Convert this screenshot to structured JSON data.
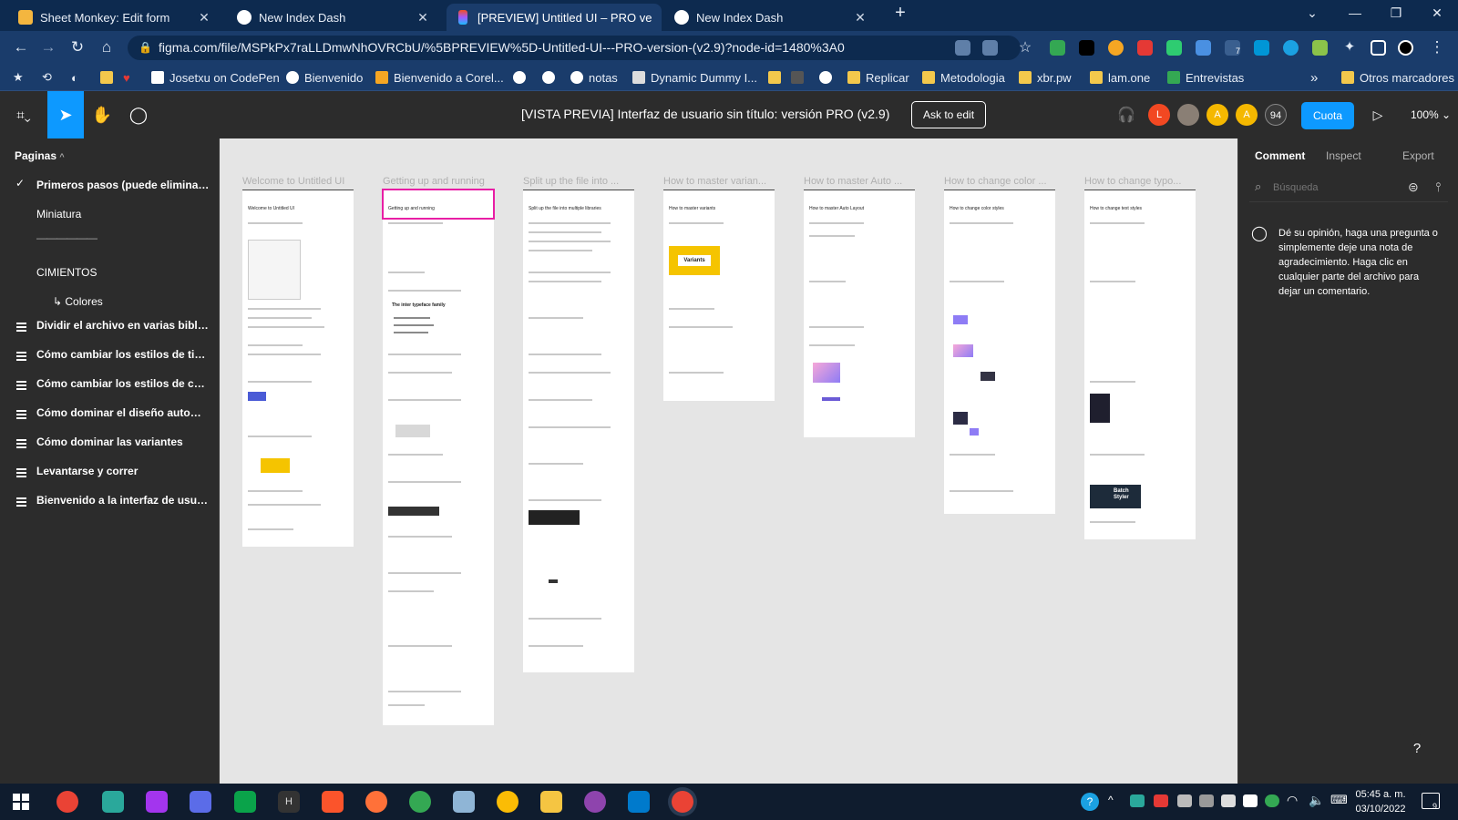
{
  "browser": {
    "tabs": [
      {
        "title": "Sheet Monkey: Edit form",
        "favicon_color": "#f4b63f"
      },
      {
        "title": "New Index Dash",
        "favicon_color": "#ffffff"
      },
      {
        "title": "[PREVIEW] Untitled UI – PRO version",
        "favicon_color": "#f24e1e",
        "active": true
      },
      {
        "title": "New Index Dash",
        "favicon_color": "#ffffff"
      }
    ],
    "url": "figma.com/file/MSPkPx7raLLDmwNhOVRCbU/%5BPREVIEW%5D-Untitled-UI---PRO-version-(v2.9)?node-id=1480%3A0",
    "extension_badge": "7",
    "bookmarks": [
      "Josetxu on CodePen",
      "Bienvenido",
      "Bienvenido a Corel...",
      "notas",
      "Dynamic Dummy I...",
      "Replicar",
      "Metodologia",
      "xbr.pw",
      "lam.one",
      "Entrevistas"
    ],
    "bookmarks_more": "»",
    "other_bookmarks": "Otros marcadores"
  },
  "figma": {
    "file_title": "[VISTA PREVIA] Interfaz de usuario sin título: versión PRO (v2.9)",
    "ask_to_edit": "Ask to edit",
    "avatars": [
      {
        "letter": "L",
        "color": "#f24822"
      },
      {
        "letter": "",
        "color": "#8a7f75"
      },
      {
        "letter": "A",
        "color": "#f5b800"
      },
      {
        "letter": "A",
        "color": "#f5b800"
      }
    ],
    "viewer_count": "94",
    "share_label": "Cuota",
    "zoom": "100%",
    "pages_label": "Paginas",
    "pages": [
      {
        "label": "Primeros pasos (puede eliminar...",
        "current": true
      },
      {
        "label": "Miniatura"
      },
      {
        "label": "——————"
      },
      {
        "label": "CIMIENTOS"
      },
      {
        "label": "↳ Colores"
      }
    ],
    "layers": [
      "Dividir el archivo en varias bibliot...",
      "Cómo cambiar los estilos de tipog...",
      "Cómo cambiar los estilos de color",
      "Cómo dominar el diseño automáti...",
      "Cómo dominar las variantes",
      "Levantarse y correr",
      "Bienvenido a la interfaz de usuari..."
    ],
    "frames": [
      {
        "label": "Welcome to Untitled UI",
        "heading": "Welcome to Untitled UI"
      },
      {
        "label": "Getting up and running",
        "heading": "Getting up and running",
        "selected": true,
        "inner_heading": "The inter typeface family"
      },
      {
        "label": "Split up the file into ...",
        "heading": "Split up the file into multiple libraries"
      },
      {
        "label": "How to master varian...",
        "heading": "How to master variants",
        "badge": "Variants"
      },
      {
        "label": "How to master Auto ...",
        "heading": "How to master Auto Layout"
      },
      {
        "label": "How to change color ...",
        "heading": "How to change color styles"
      },
      {
        "label": "How to change typo...",
        "heading": "How to change text styles",
        "badge": "Batch Styler"
      }
    ],
    "right_panel": {
      "tabs": [
        "Comment",
        "Inspect",
        "Export"
      ],
      "search_placeholder": "Búsqueda",
      "hint": "Dé su opinión, haga una pregunta o simplemente deje una nota de agradecimiento. Haga clic en cualquier parte del archivo para dejar un comentario."
    },
    "help": "?"
  },
  "taskbar": {
    "time": "05:45 a. m.",
    "date": "03/10/2022",
    "notification_count": "9",
    "app_h_label": "H"
  },
  "colors": {
    "accent": "#0d99ff",
    "selection": "#e81ea5",
    "chrome_dark": "#0d2a4f",
    "chrome_mid": "#1a3c6b",
    "figma_dark": "#2c2c2c",
    "canvas": "#e5e5e5"
  }
}
